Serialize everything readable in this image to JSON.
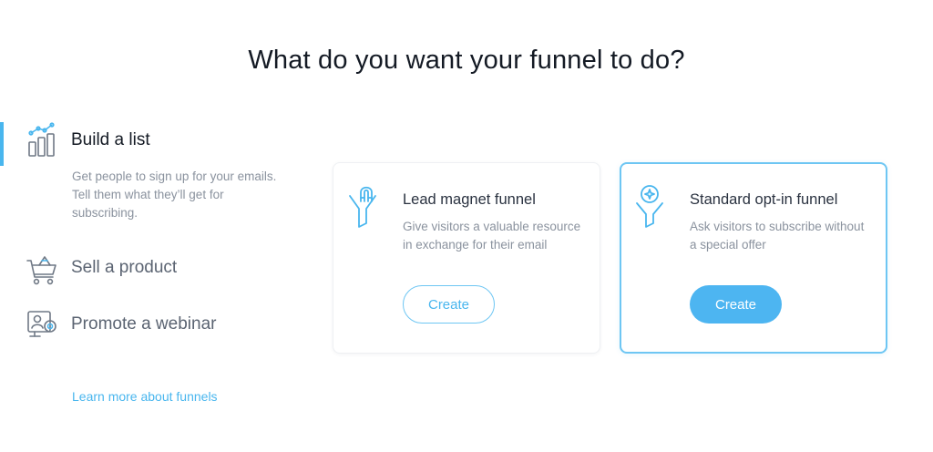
{
  "header": {
    "title": "What do you want your funnel to do?"
  },
  "goals": [
    {
      "label": "Build a list",
      "description": "Get people to sign up for your emails. Tell them what they’ll get for subscribing.",
      "icon": "chart-growth-icon",
      "active": true
    },
    {
      "label": "Sell a product",
      "icon": "shopping-cart-icon",
      "active": false
    },
    {
      "label": "Promote a webinar",
      "icon": "webinar-icon",
      "active": false
    }
  ],
  "footer": {
    "learn_link": "Learn more about funnels"
  },
  "cards": [
    {
      "title": "Lead magnet funnel",
      "description": "Give visitors a valuable resource in exchange for their email",
      "button": "Create",
      "icon": "magnet-funnel-icon",
      "selected": false
    },
    {
      "title": "Standard opt-in funnel",
      "description": "Ask visitors to subscribe without a special offer",
      "button": "Create",
      "icon": "optin-funnel-icon",
      "selected": true
    }
  ],
  "colors": {
    "accent": "#49b6ee",
    "accent_button": "#4db5f1",
    "text_dark": "#141a24",
    "text_muted": "#8a929e",
    "icon_gray": "#6f7885"
  }
}
